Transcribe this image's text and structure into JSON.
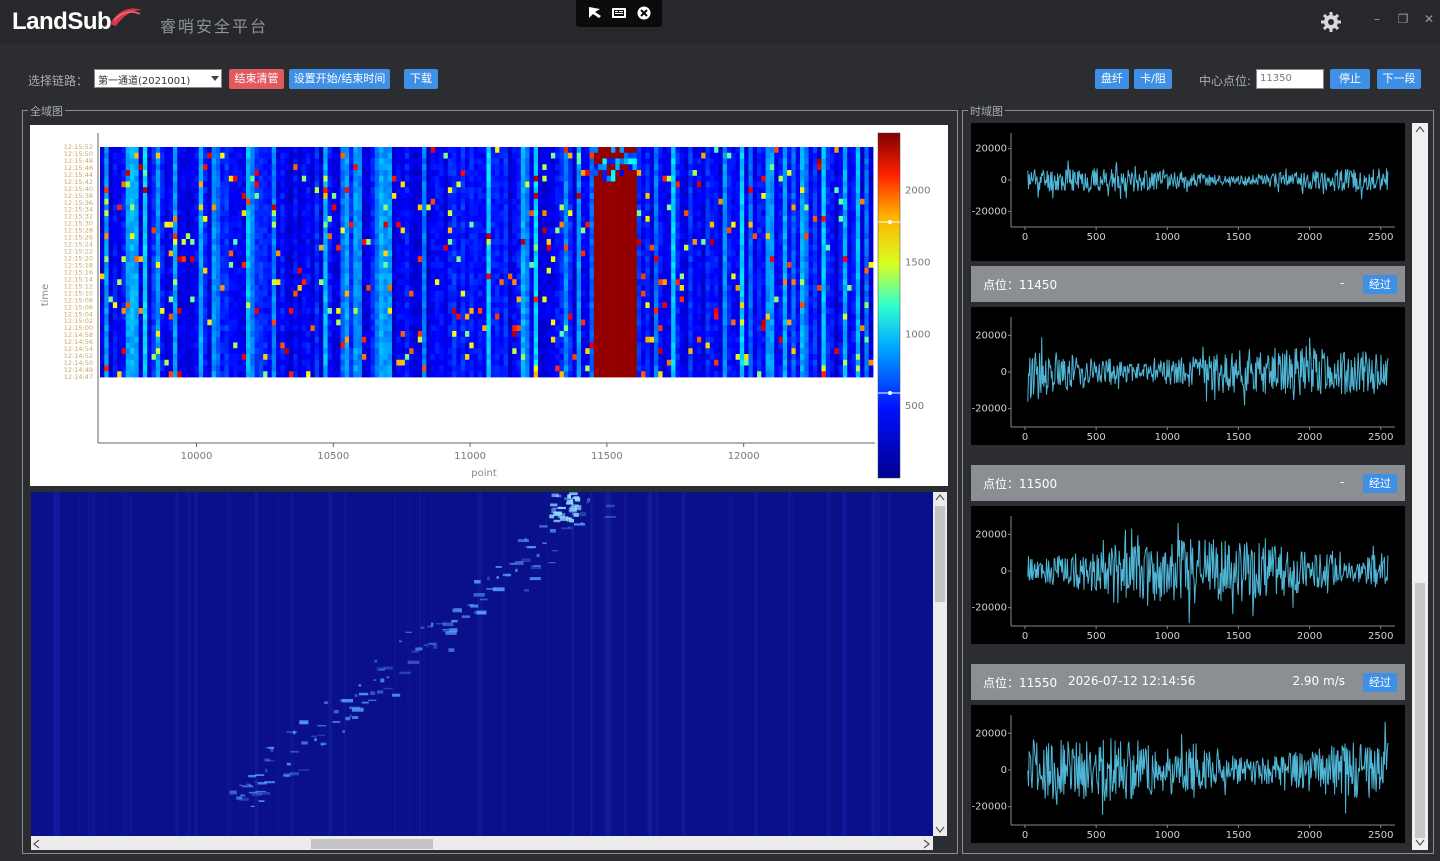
{
  "app": {
    "logo_text": "LandSub",
    "title": "睿哨安全平台"
  },
  "window_controls": [
    "–",
    "❐",
    "✕"
  ],
  "icons": {
    "settings": "gear-icon",
    "pointer": "pointer-icon",
    "screen": "screen-icon",
    "close": "close-circle-icon"
  },
  "controls": {
    "link_label": "选择链路：",
    "link_value": "第一通道(2021001)",
    "stop_monitor_label": "结束清管",
    "set_time_label": "设置开始/结束时间",
    "download_label": "下载",
    "fiber_label": "盘纤",
    "stuck_label": "卡/阻",
    "center_point_label": "中心点位:",
    "center_point_value": "11350",
    "stop_label": "停止",
    "next_label": "下一段"
  },
  "panels": {
    "overview_title": "全域图",
    "timeseries_title": "时域图"
  },
  "heatmap": {
    "y_axis_label": "time",
    "x_axis_label": "point",
    "x_ticks": [
      "10000",
      "10500",
      "11000",
      "11500",
      "12000"
    ],
    "y_ticks": [
      "12:15:52",
      "12:15:50",
      "12:15:48",
      "12:15:46",
      "12:15:44",
      "12:15:42",
      "12:15:40",
      "12:15:38",
      "12:15:36",
      "12:15:34",
      "12:15:32",
      "12:15:30",
      "12:15:28",
      "12:15:26",
      "12:15:24",
      "12:15:22",
      "12:15:20",
      "12:15:18",
      "12:15:16",
      "12:15:14",
      "12:15:12",
      "12:15:10",
      "12:15:08",
      "12:15:06",
      "12:15:04",
      "12:15:02",
      "12:15:00",
      "12:14:58",
      "12:14:56",
      "12:14:54",
      "12:14:52",
      "12:14:50",
      "12:14:49",
      "12:14:47"
    ],
    "colorbar_ticks": [
      "2000",
      "1500",
      "1000",
      "500"
    ],
    "colors": {
      "low": "#00008b",
      "mid": "#00a0ff",
      "high": "#7f0000"
    }
  },
  "waveforms": {
    "y_ticks": [
      "20000",
      "0",
      "-20000"
    ],
    "x_ticks": [
      "0",
      "500",
      "1000",
      "1500",
      "2000",
      "2500"
    ],
    "line_color": "#4fb6d6"
  },
  "points": [
    {
      "label": "点位：11450",
      "time": "",
      "speed": "",
      "dash": "-",
      "button": "经过"
    },
    {
      "label": "点位：11500",
      "time": "",
      "speed": "",
      "dash": "-",
      "button": "经过"
    },
    {
      "label": "点位：11550",
      "time": "2026-07-12 12:14:56",
      "speed": "2.90 m/s",
      "dash": "",
      "button": "经过"
    }
  ],
  "chart_data": [
    {
      "type": "heatmap",
      "title": "",
      "xlabel": "point",
      "ylabel": "time",
      "x_ticks": [
        10000,
        10500,
        11000,
        11500,
        12000
      ],
      "xlim": [
        9640,
        12480
      ],
      "color_scale": [
        0,
        2400
      ],
      "colorbar_ticks": [
        500,
        1000,
        1500,
        2000
      ],
      "hotspot_x_range": [
        11450,
        11600
      ]
    }
  ]
}
